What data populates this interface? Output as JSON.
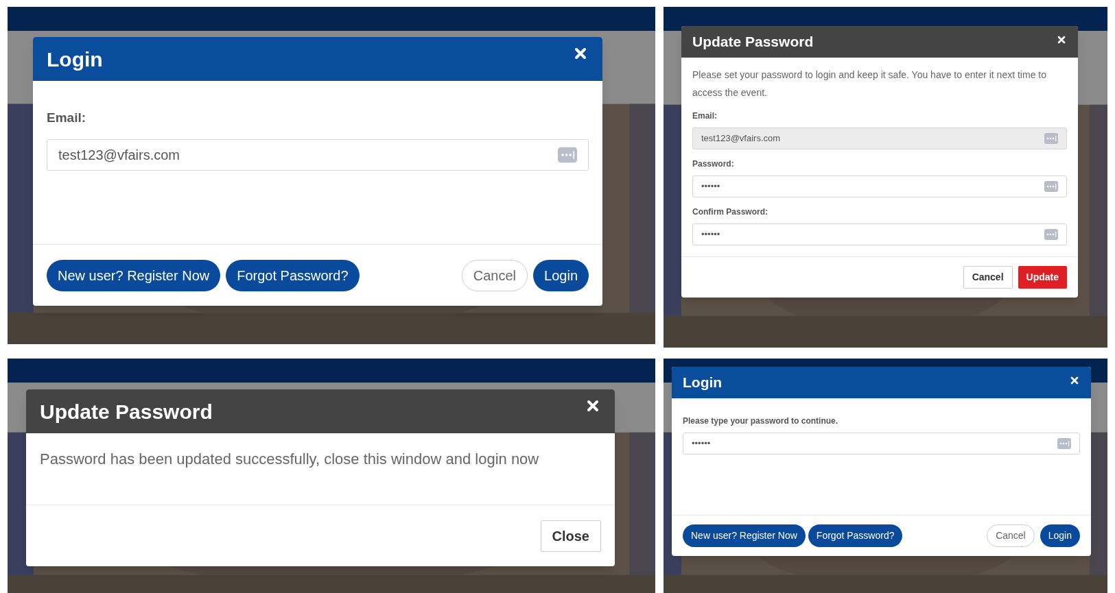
{
  "panels": [
    {
      "dialog": {
        "kind": "login",
        "title": "Login",
        "fields": [
          {
            "label": "Email:",
            "value": "test123@vfairs.com",
            "disabled": false
          }
        ],
        "left_buttons": [
          {
            "label": "New user? Register Now",
            "kind": "pill"
          },
          {
            "label": "Forgot Password?",
            "kind": "pill"
          }
        ],
        "right_buttons": [
          {
            "label": "Cancel",
            "kind": "pill_outline"
          },
          {
            "label": "Login",
            "kind": "pill"
          }
        ]
      }
    },
    {
      "dialog": {
        "kind": "notice",
        "title": "Update Password",
        "message": "Please set your password to login and keep it safe. You have to enter it next time to access the event.",
        "fields": [
          {
            "label": "Email:",
            "value": "test123@vfairs.com",
            "disabled": true
          },
          {
            "label": "Password:",
            "value": "••••••",
            "disabled": false
          },
          {
            "label": "Confirm Password:",
            "value": "••••••",
            "disabled": false
          }
        ],
        "right_buttons": [
          {
            "label": "Cancel",
            "kind": "square"
          },
          {
            "label": "Update",
            "kind": "square_danger"
          }
        ]
      }
    },
    {
      "dialog": {
        "kind": "notice",
        "title": "Update Password",
        "message": "Password has been updated successfully, close this window and login now",
        "right_buttons": [
          {
            "label": "Close",
            "kind": "square"
          }
        ]
      }
    },
    {
      "dialog": {
        "kind": "login",
        "title": "Login",
        "fields": [
          {
            "label": "Please type your password to continue.",
            "value": "••••••",
            "disabled": false
          }
        ],
        "left_buttons": [
          {
            "label": "New user? Register Now",
            "kind": "pill"
          },
          {
            "label": "Forgot Password?",
            "kind": "pill"
          }
        ],
        "right_buttons": [
          {
            "label": "Cancel",
            "kind": "pill_outline"
          },
          {
            "label": "Login",
            "kind": "pill"
          }
        ]
      }
    }
  ]
}
